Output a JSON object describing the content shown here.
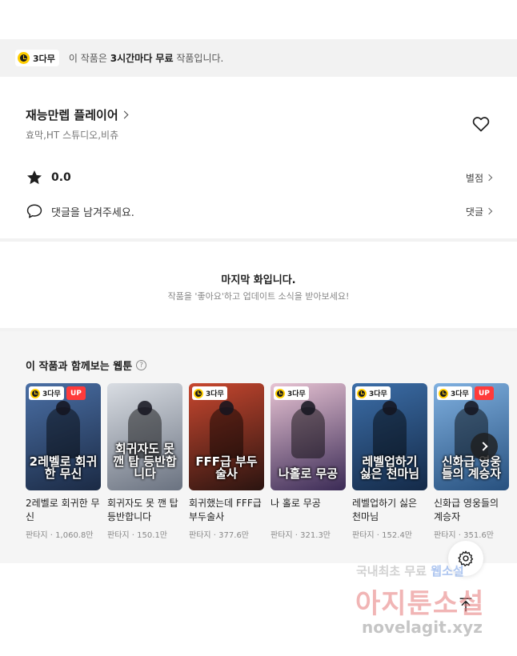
{
  "notice": {
    "badge_label": "3다무",
    "text_prefix": "이 작품은",
    "text_bold": "3시간마다 무료",
    "text_suffix": "작품입니다."
  },
  "work": {
    "title": "재능만렙 플레이어",
    "authors": "효막,HT 스튜디오,비츄"
  },
  "rating": {
    "value": "0.0",
    "link_label": "별점"
  },
  "comment": {
    "prompt": "댓글을 남겨주세요.",
    "link_label": "댓글"
  },
  "last_episode": {
    "title": "마지막 화입니다.",
    "subtitle": "작품을 '좋아요'하고 업데이트 소식을 받아보세요!"
  },
  "recommendations": {
    "heading": "이 작품과 함께보는 웹툰",
    "help_glyph": "?",
    "items": [
      {
        "title": "2레벨로 회귀한 무신",
        "art_title": "2레벨로 회귀한 무신",
        "genre": "판타지",
        "views": "1,060.8만",
        "badge": "3다무",
        "up": "UP",
        "bg1": "#4a6fa5",
        "bg2": "#1b2a44"
      },
      {
        "title": "회귀자도 못 깬 탑 등반합니다",
        "art_title": "회귀자도 못깬 탑 등반합니다",
        "genre": "판타지",
        "views": "150.1만",
        "badge": "",
        "up": "",
        "bg1": "#d9dde3",
        "bg2": "#6a7280"
      },
      {
        "title": "회귀했는데 FFF급 부두술사",
        "art_title": "FFF급 부두술사",
        "genre": "판타지",
        "views": "377.6만",
        "badge": "3다무",
        "up": "",
        "bg1": "#c8472f",
        "bg2": "#2a1410"
      },
      {
        "title": "나 홀로 무공",
        "art_title": "나홀로 무공",
        "genre": "판타지",
        "views": "321.3만",
        "badge": "3다무",
        "up": "",
        "bg1": "#e7c3d3",
        "bg2": "#3a2a55"
      },
      {
        "title": "레벨업하기 싫은 천마님",
        "art_title": "레벨업하기 싫은 천마님",
        "genre": "판타지",
        "views": "152.4만",
        "badge": "3다무",
        "up": "",
        "bg1": "#3c6ea8",
        "bg2": "#142a48"
      },
      {
        "title": "신화급 영웅들의 계승자",
        "art_title": "신화급 영웅들의 계승자",
        "genre": "판타지",
        "views": "351.6만",
        "badge": "3다무",
        "up": "UP",
        "bg1": "#7fb0e0",
        "bg2": "#27507e"
      }
    ]
  },
  "meta_separator": "·",
  "watermark": {
    "line1_a": "국내최초 무료",
    "line1_b": "웹소설",
    "line2": "아지툰소설",
    "line3": "novelagit.xyz"
  },
  "colors": {
    "accent_yellow": "#ffce00",
    "up_red": "#ff3b3b",
    "section_gray": "#f2f2f2"
  }
}
